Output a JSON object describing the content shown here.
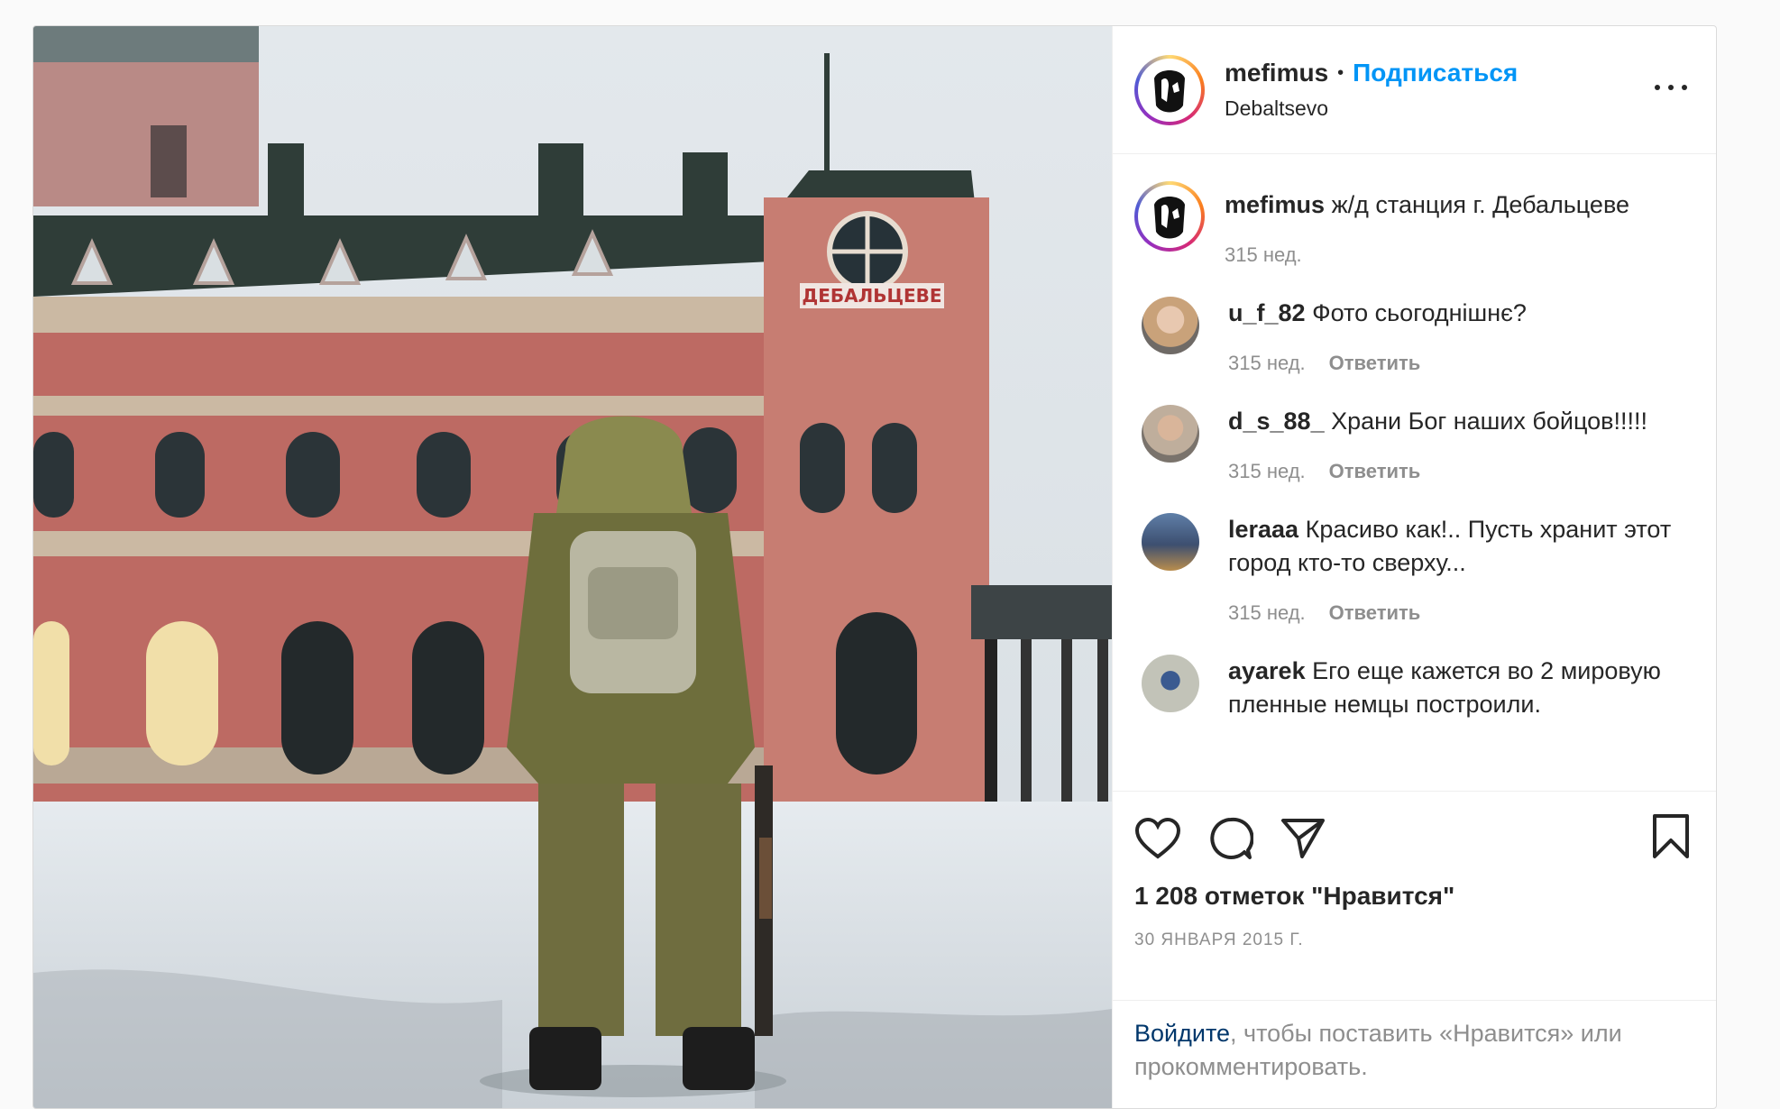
{
  "post": {
    "author": {
      "username": "mefimus",
      "follow_label": "Подписаться",
      "separator": "•",
      "location": "Debaltsevo"
    },
    "photo": {
      "sign_text": "ДЕБАЛЬЦЕВЕ"
    },
    "caption": {
      "username": "mefimus",
      "text": "ж/д станция г. Дебальцеве",
      "time": "315 нед."
    },
    "comments": [
      {
        "username": "u_f_82",
        "text": "Фото сьогоднішнє?",
        "time": "315 нед.",
        "reply_label": "Ответить"
      },
      {
        "username": "d_s_88_",
        "text": "Храни Бог наших бойцов!!!!!",
        "time": "315 нед.",
        "reply_label": "Ответить"
      },
      {
        "username": "leraaa",
        "text": "Красиво как!.. Пусть хранит этот город кто-то сверху...",
        "time": "315 нед.",
        "reply_label": "Ответить"
      },
      {
        "username": "ayarek",
        "text": "Его еще кажется во 2 мировую пленные немцы построили.",
        "time": "",
        "reply_label": ""
      }
    ],
    "likes_text": "1 208 отметок \"Нравится\"",
    "date_text": "30 января 2015 г.",
    "login_prompt": {
      "link": "Войдите",
      "rest": ", чтобы поставить «Нравится» или прокомментировать."
    },
    "icons": [
      "heart-icon",
      "comment-icon",
      "share-icon",
      "bookmark-icon",
      "more-icon"
    ],
    "colors": {
      "accent": "#0095f6",
      "text": "#262626",
      "muted": "#8e8e8e"
    }
  }
}
